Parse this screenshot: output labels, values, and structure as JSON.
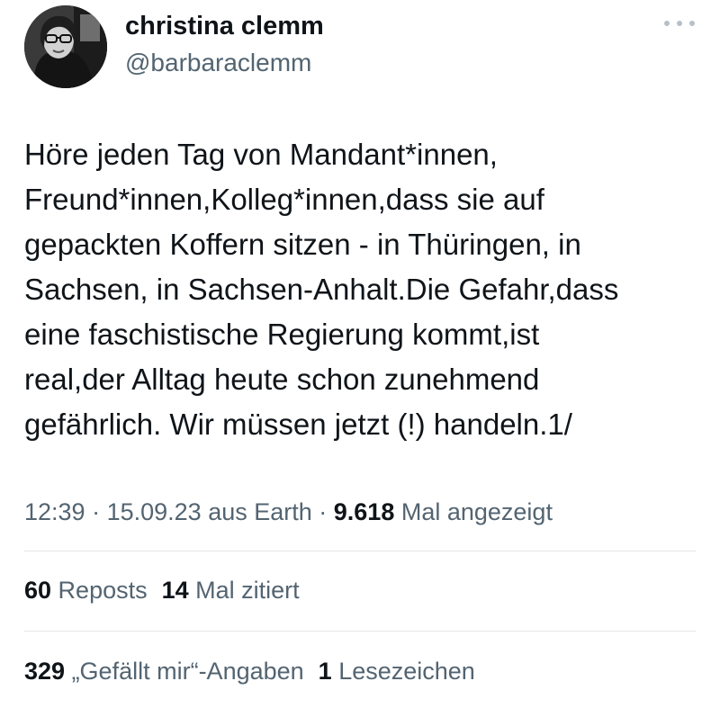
{
  "author": {
    "display_name": "christina clemm",
    "handle": "@barbaraclemm"
  },
  "icons": {
    "more": "more-horizontal-icon"
  },
  "tweet": {
    "lines": [
      "Höre jeden Tag von Mandant*innen,",
      "Freund*innen,Kolleg*innen,dass sie auf",
      "gepackten Koffern sitzen - in Thüringen, in",
      "Sachsen, in Sachsen-Anhalt.Die Gefahr,dass",
      "eine faschistische Regierung kommt,ist",
      "real,der Alltag heute schon zunehmend",
      "gefährlich. Wir müssen jetzt (!) handeln.1/"
    ]
  },
  "meta": {
    "time": "12:39",
    "separator1": " · ",
    "date": "15.09.23",
    "source": " aus Earth",
    "separator2": " · ",
    "views_count": "9.618",
    "views_label": " Mal angezeigt"
  },
  "stats": {
    "reposts_count": "60",
    "reposts_label": " Reposts",
    "quotes_count": "14",
    "quotes_label": " Mal zitiert",
    "likes_count": "329",
    "likes_label": " „Gefällt mir“-Angaben",
    "bookmarks_count": "1",
    "bookmarks_label": " Lesezeichen"
  },
  "colors": {
    "text_primary": "#0f1419",
    "text_secondary": "#536471",
    "divider": "#e3e7ea",
    "background": "#ffffff"
  }
}
